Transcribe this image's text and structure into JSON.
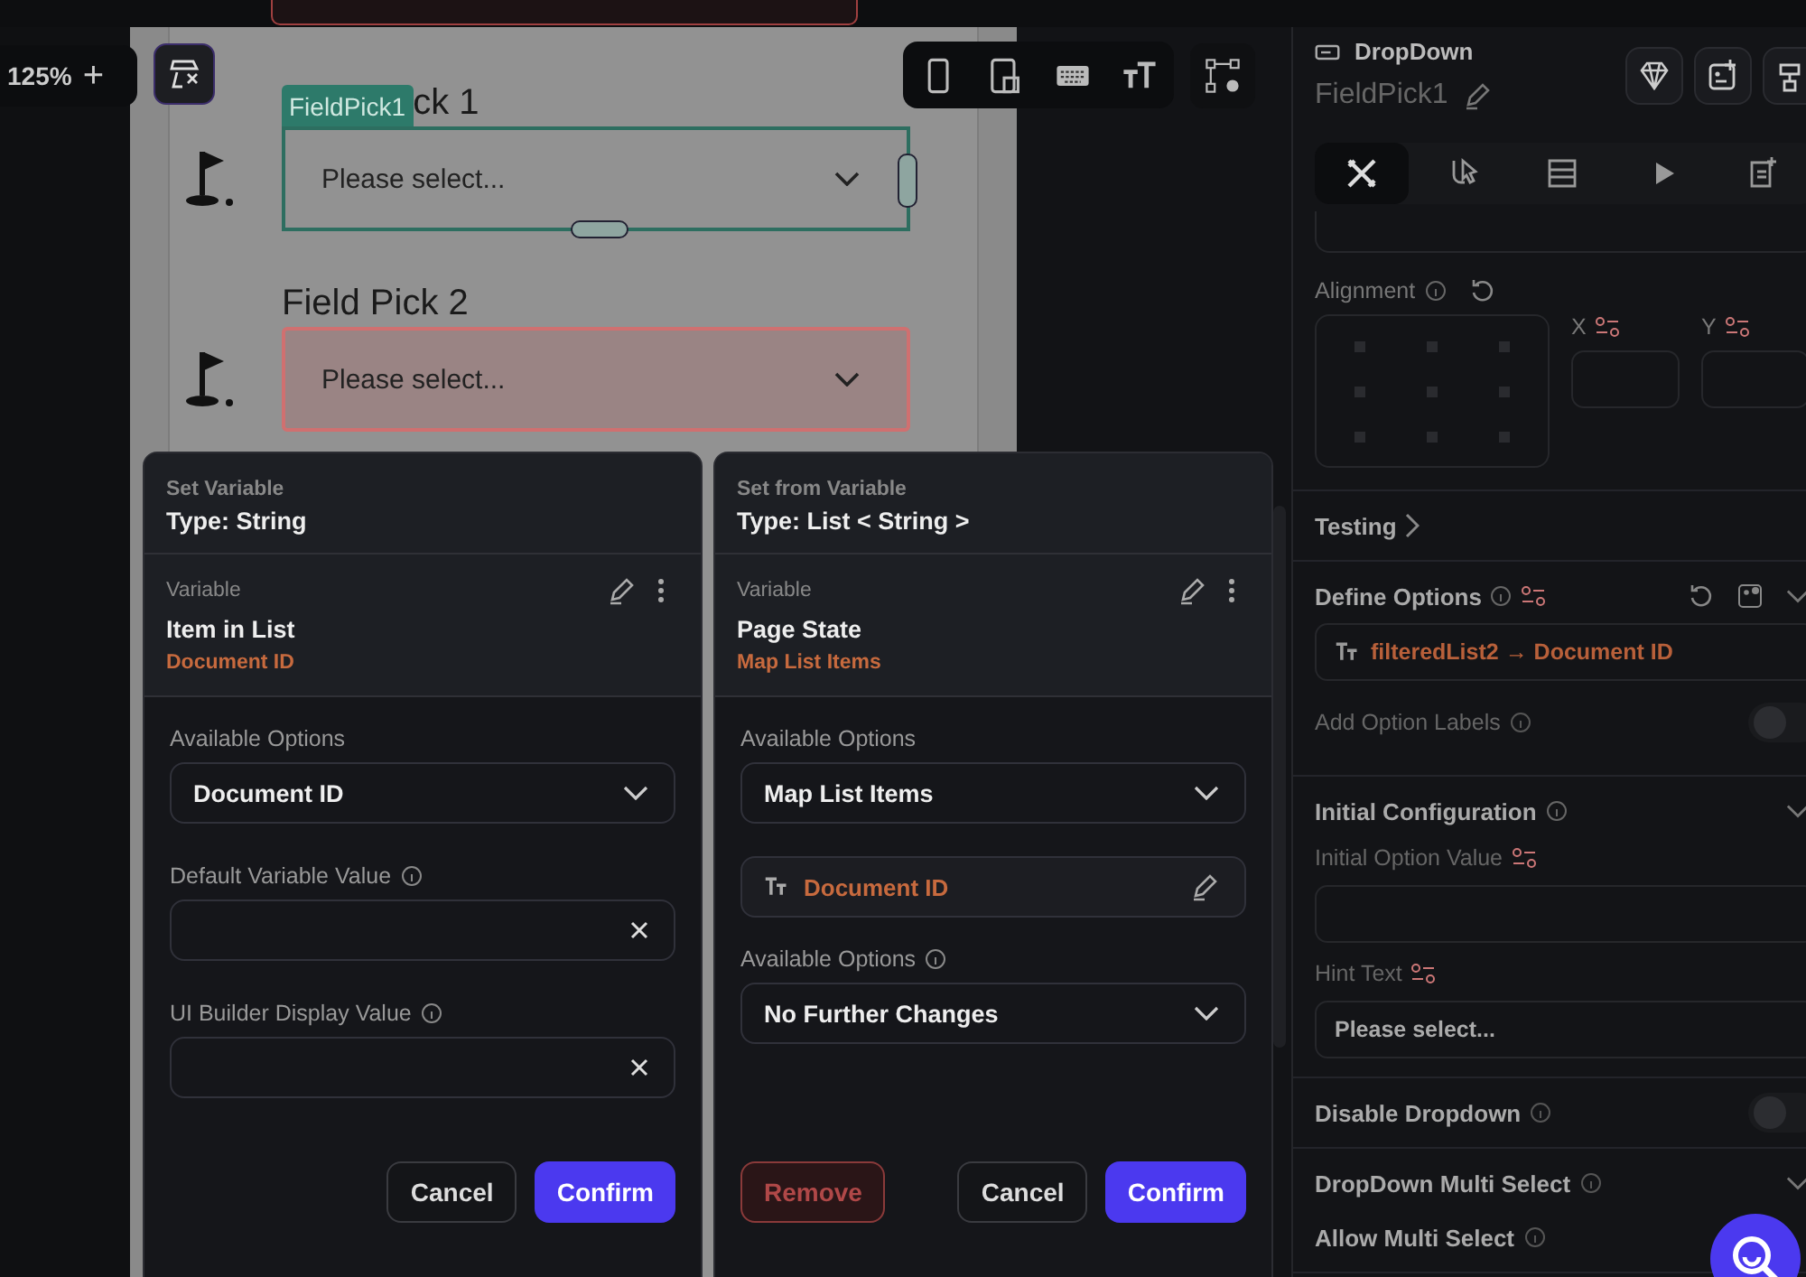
{
  "zoom": {
    "value": "125%",
    "plus": "+"
  },
  "canvas": {
    "fields": [
      {
        "tag": "FieldPick1",
        "label": "ck 1",
        "placeholder": "Please select...",
        "selected": true,
        "error": false
      },
      {
        "label": "Field Pick 2",
        "placeholder": "Please select...",
        "selected": false,
        "error": true
      }
    ]
  },
  "panel": {
    "type": "DropDown",
    "name": "FieldPick1",
    "tabs": [
      {
        "selected": true
      },
      {
        "selected": false
      },
      {
        "selected": false
      },
      {
        "selected": false
      },
      {
        "selected": false
      }
    ],
    "alignment": {
      "label": "Alignment",
      "x": "X",
      "y": "Y"
    },
    "sections": [
      {
        "kind": "collapsed",
        "title": "Testing"
      },
      {
        "kind": "options",
        "title": "Define Options",
        "value": "filteredList2 → Document ID",
        "toggle_label": "Add Option Labels",
        "on": false
      },
      {
        "kind": "config",
        "title": "Initial Configuration",
        "initial_label": "Initial Option Value",
        "hint_label": "Hint Text",
        "hint_value": "Please select..."
      },
      {
        "kind": "toggle",
        "title": "Disable Dropdown",
        "on": false
      },
      {
        "kind": "multi",
        "title": "DropDown Multi Select",
        "sub": "Allow Multi Select"
      }
    ]
  },
  "modals": [
    {
      "caption": "Set Variable",
      "type": "Type: String",
      "var_caption": "Variable",
      "var_name": "Item in List",
      "var_path": "Document ID",
      "fields": [
        {
          "kind": "select",
          "label": "Available Options",
          "info": false,
          "value": "Document ID"
        },
        {
          "kind": "input",
          "label": "Default Variable Value",
          "info": true
        },
        {
          "kind": "input",
          "label": "UI Builder Display Value",
          "info": true
        }
      ],
      "buttons": [
        {
          "kind": "secondary",
          "label": "Cancel"
        },
        {
          "kind": "primary",
          "label": "Confirm"
        }
      ]
    },
    {
      "caption": "Set from Variable",
      "type": "Type: List < String >",
      "var_caption": "Variable",
      "var_name": "Page State",
      "var_path": "Map List Items",
      "fields": [
        {
          "kind": "select",
          "label": "Available Options",
          "info": false,
          "value": "Map List Items"
        },
        {
          "kind": "mapping",
          "value": "Document ID"
        },
        {
          "kind": "select",
          "label": "Available Options",
          "info": true,
          "value": "No Further Changes"
        }
      ],
      "buttons": [
        {
          "kind": "danger",
          "label": "Remove"
        },
        {
          "kind": "secondary",
          "label": "Cancel"
        },
        {
          "kind": "primary",
          "label": "Confirm"
        }
      ]
    }
  ]
}
